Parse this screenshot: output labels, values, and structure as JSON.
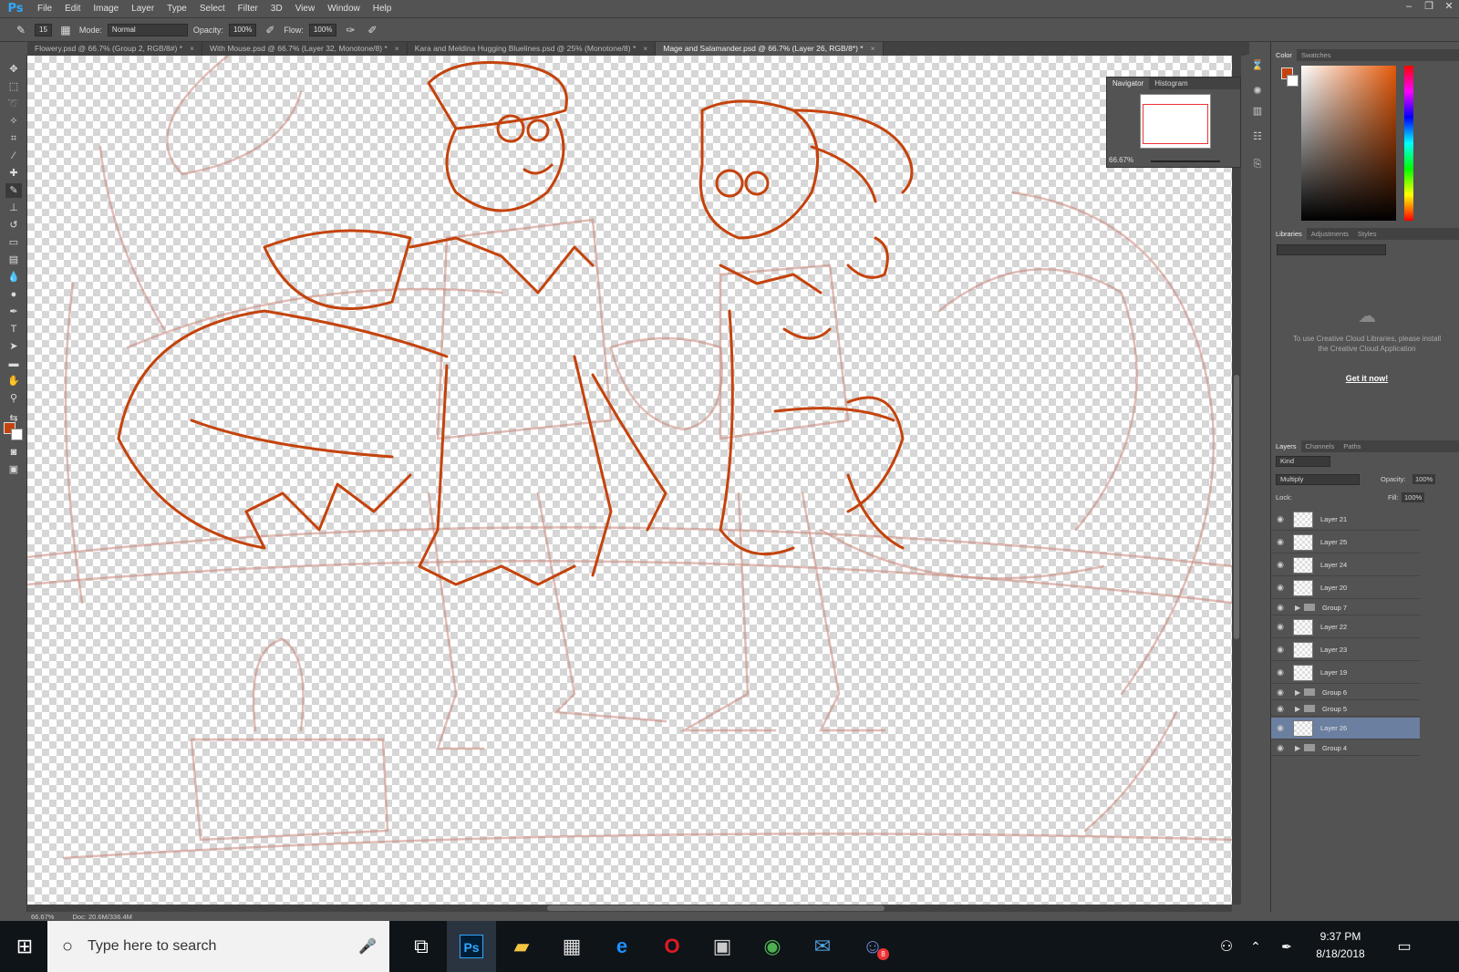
{
  "app": {
    "logo": "Ps"
  },
  "menu": [
    "File",
    "Edit",
    "Image",
    "Layer",
    "Type",
    "Select",
    "Filter",
    "3D",
    "View",
    "Window",
    "Help"
  ],
  "window_controls": [
    "–",
    "❐",
    "✕"
  ],
  "options": {
    "brush_size": "15",
    "mode_label": "Mode:",
    "mode_value": "Normal",
    "opacity_label": "Opacity:",
    "opacity_value": "100%",
    "flow_label": "Flow:",
    "flow_value": "100%"
  },
  "tabs": [
    {
      "label": "Flowery.psd @ 66.7% (Group 2, RGB/8#) *",
      "active": false
    },
    {
      "label": "With Mouse.psd @ 66.7% (Layer 32, Monotone/8) *",
      "active": false
    },
    {
      "label": "Kara and Meldina Hugging Bluelines.psd @ 25% (Monotone/8) *",
      "active": false
    },
    {
      "label": "Mage and Salamander.psd @ 66.7% (Layer 26, RGB/8*) *",
      "active": true
    }
  ],
  "tab_close": "×",
  "status": {
    "zoom": "66.67%",
    "doc": "Doc: 20.6M/336.4M"
  },
  "navigator": {
    "tabs": [
      "Navigator",
      "Histogram"
    ],
    "zoom": "66.67%"
  },
  "color_panel": {
    "tabs": [
      "Color",
      "Swatches"
    ],
    "fg": "#c4430d",
    "bg": "#ffffff"
  },
  "libraries_panel": {
    "tabs": [
      "Libraries",
      "Adjustments",
      "Styles"
    ],
    "message": "To use Creative Cloud Libraries, please install the Creative Cloud Application",
    "button": "Get it now!"
  },
  "layers_panel": {
    "tabs": [
      "Layers",
      "Channels",
      "Paths"
    ],
    "kind": "Kind",
    "blend_mode": "Multiply",
    "opacity_label": "Opacity:",
    "opacity_value": "100%",
    "lock_label": "Lock:",
    "fill_label": "Fill:",
    "fill_value": "100%",
    "layers": [
      {
        "name": "Layer 21",
        "type": "layer",
        "selected": false
      },
      {
        "name": "Layer 25",
        "type": "layer",
        "selected": false
      },
      {
        "name": "Layer 24",
        "type": "layer",
        "selected": false
      },
      {
        "name": "Layer 20",
        "type": "layer",
        "selected": false
      },
      {
        "name": "Group 7",
        "type": "group",
        "selected": false
      },
      {
        "name": "Layer 22",
        "type": "layer",
        "selected": false
      },
      {
        "name": "Layer 23",
        "type": "layer",
        "selected": false
      },
      {
        "name": "Layer 19",
        "type": "layer",
        "selected": false
      },
      {
        "name": "Group 6",
        "type": "group",
        "selected": false
      },
      {
        "name": "Group 5",
        "type": "group",
        "selected": false
      },
      {
        "name": "Layer 26",
        "type": "layer",
        "selected": true
      },
      {
        "name": "Group 4",
        "type": "group",
        "selected": false
      }
    ]
  },
  "taskbar": {
    "search_placeholder": "Type here to search",
    "time": "9:37 PM",
    "date": "8/18/2018",
    "apps": [
      "windows-start",
      "task-view",
      "photoshop",
      "file-explorer",
      "store",
      "edge",
      "opera",
      "app",
      "chrome",
      "mail",
      "discord"
    ],
    "ps_label": "Ps",
    "notification_badge": "8"
  },
  "colors": {
    "sketch_light": "#c9877a",
    "sketch_dark": "#c4430d",
    "accent_layer": "#6b7fa0"
  }
}
